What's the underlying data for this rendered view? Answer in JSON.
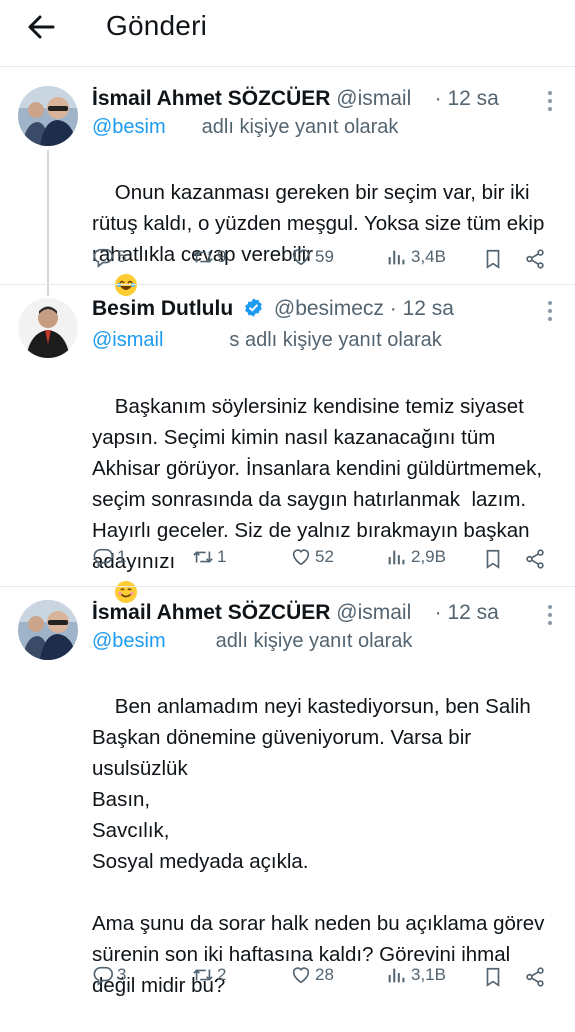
{
  "header": {
    "title": "Gönderi"
  },
  "tweets": [
    {
      "name": "İsmail Ahmet SÖZCÜER",
      "handle": "@ismail",
      "time": "12 sa",
      "verified": false,
      "reply_mention": "@besim",
      "reply_suffix": "adlı kişiye yanıt olarak",
      "body": "Onun kazanması gereken bir seçim var, bir iki rütuş kaldı, o yüzden meşgul. Yoksa size tüm ekip rahatlıkla cevap verebilir",
      "emoji": "😂",
      "replies": "5",
      "retweets": "9",
      "likes": "59",
      "views": "3,4B"
    },
    {
      "name": "Besim Dutlulu",
      "handle": "@besimecz",
      "time": "12 sa",
      "verified": true,
      "reply_mention": "@ismail",
      "reply_suffix": "s adlı kişiye yanıt olarak",
      "body": "Başkanım söylersiniz kendisine temiz siyaset yapsın. Seçimi kimin nasıl kazanacağını tüm Akhisar görüyor. İnsanlara kendini güldürtmemek, seçim sonrasında da saygın hatırlanmak  lazım. Hayırlı geceler. Siz de yalnız bırakmayın başkan adayınızı",
      "emoji": "😊",
      "replies": "1",
      "retweets": "1",
      "likes": "52",
      "views": "2,9B"
    },
    {
      "name": "İsmail Ahmet SÖZCÜER",
      "handle": "@ismail",
      "time": "12 sa",
      "verified": false,
      "reply_mention": "@besim",
      "reply_suffix": "adlı kişiye yanıt olarak",
      "body": "Ben anlamadım neyi kastediyorsun, ben Salih Başkan dönemine güveniyorum. Varsa bir usulsüzlük\nBasın,\nSavcılık,\nSosyal medyada açıkla.\n\nAma şunu da sorar halk neden bu açıklama görev sürenin son iki haftasına kaldı? Görevini ihmal değil midir bu?",
      "emoji": "",
      "replies": "3",
      "retweets": "2",
      "likes": "28",
      "views": "3,1B"
    }
  ],
  "colors": {
    "accent": "#1d9bf0",
    "text": "#0f1419",
    "muted": "#536471",
    "divider": "#e6e9eb"
  },
  "icons": [
    "back-arrow-icon",
    "verified-badge-icon",
    "more-options-icon",
    "reply-icon",
    "retweet-icon",
    "like-icon",
    "views-icon",
    "bookmark-icon",
    "share-icon"
  ]
}
